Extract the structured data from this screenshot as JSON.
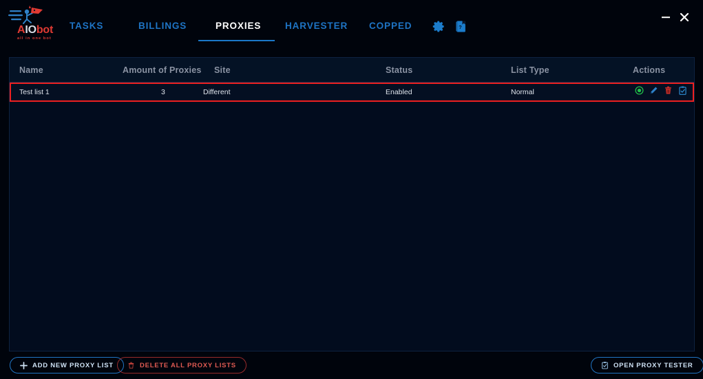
{
  "app": {
    "logo": {
      "name_part_a": "A",
      "name_part_io": "IO",
      "name_part_bot": "bot",
      "tagline": "all in one bot"
    }
  },
  "titlebar": {
    "minimize_label": "—",
    "close_label": "✕"
  },
  "nav": {
    "tabs": [
      {
        "label": "TASKS",
        "active": false
      },
      {
        "label": "BILLINGS",
        "active": false
      },
      {
        "label": "PROXIES",
        "active": true
      },
      {
        "label": "HARVESTER",
        "active": false
      },
      {
        "label": "COPPED",
        "active": false
      }
    ],
    "icons": [
      {
        "name": "settings-gear-icon",
        "label": "Settings"
      },
      {
        "name": "guide-book-icon",
        "label": "Guide"
      }
    ]
  },
  "table": {
    "columns": [
      {
        "key": "name",
        "label": "Name"
      },
      {
        "key": "amount",
        "label": "Amount of Proxies"
      },
      {
        "key": "site",
        "label": "Site"
      },
      {
        "key": "status",
        "label": "Status"
      },
      {
        "key": "type",
        "label": "List Type"
      },
      {
        "key": "actions",
        "label": "Actions"
      }
    ],
    "rows": [
      {
        "name": "Test list 1",
        "amount": "3",
        "site": "Different",
        "status": "Enabled",
        "type": "Normal",
        "selected": true,
        "actions": [
          {
            "name": "toggle-status-icon",
            "label": "Toggle status"
          },
          {
            "name": "edit-icon",
            "label": "Edit"
          },
          {
            "name": "delete-icon",
            "label": "Delete"
          },
          {
            "name": "test-proxies-icon",
            "label": "Test proxies"
          }
        ]
      }
    ]
  },
  "footer": {
    "add_new_proxy_list": "ADD NEW PROXY LIST",
    "delete_all_proxy_lists": "DELETE ALL PROXY LISTS",
    "open_proxy_tester": "OPEN PROXY TESTER"
  },
  "colors": {
    "accent_blue": "#1e74c4",
    "accent_red": "#e03a33",
    "selection_red": "#ee2020",
    "panel_bg": "#020c1e",
    "header_bg": "#041225",
    "window_bg": "#00040c",
    "status_green": "#21c04a"
  }
}
